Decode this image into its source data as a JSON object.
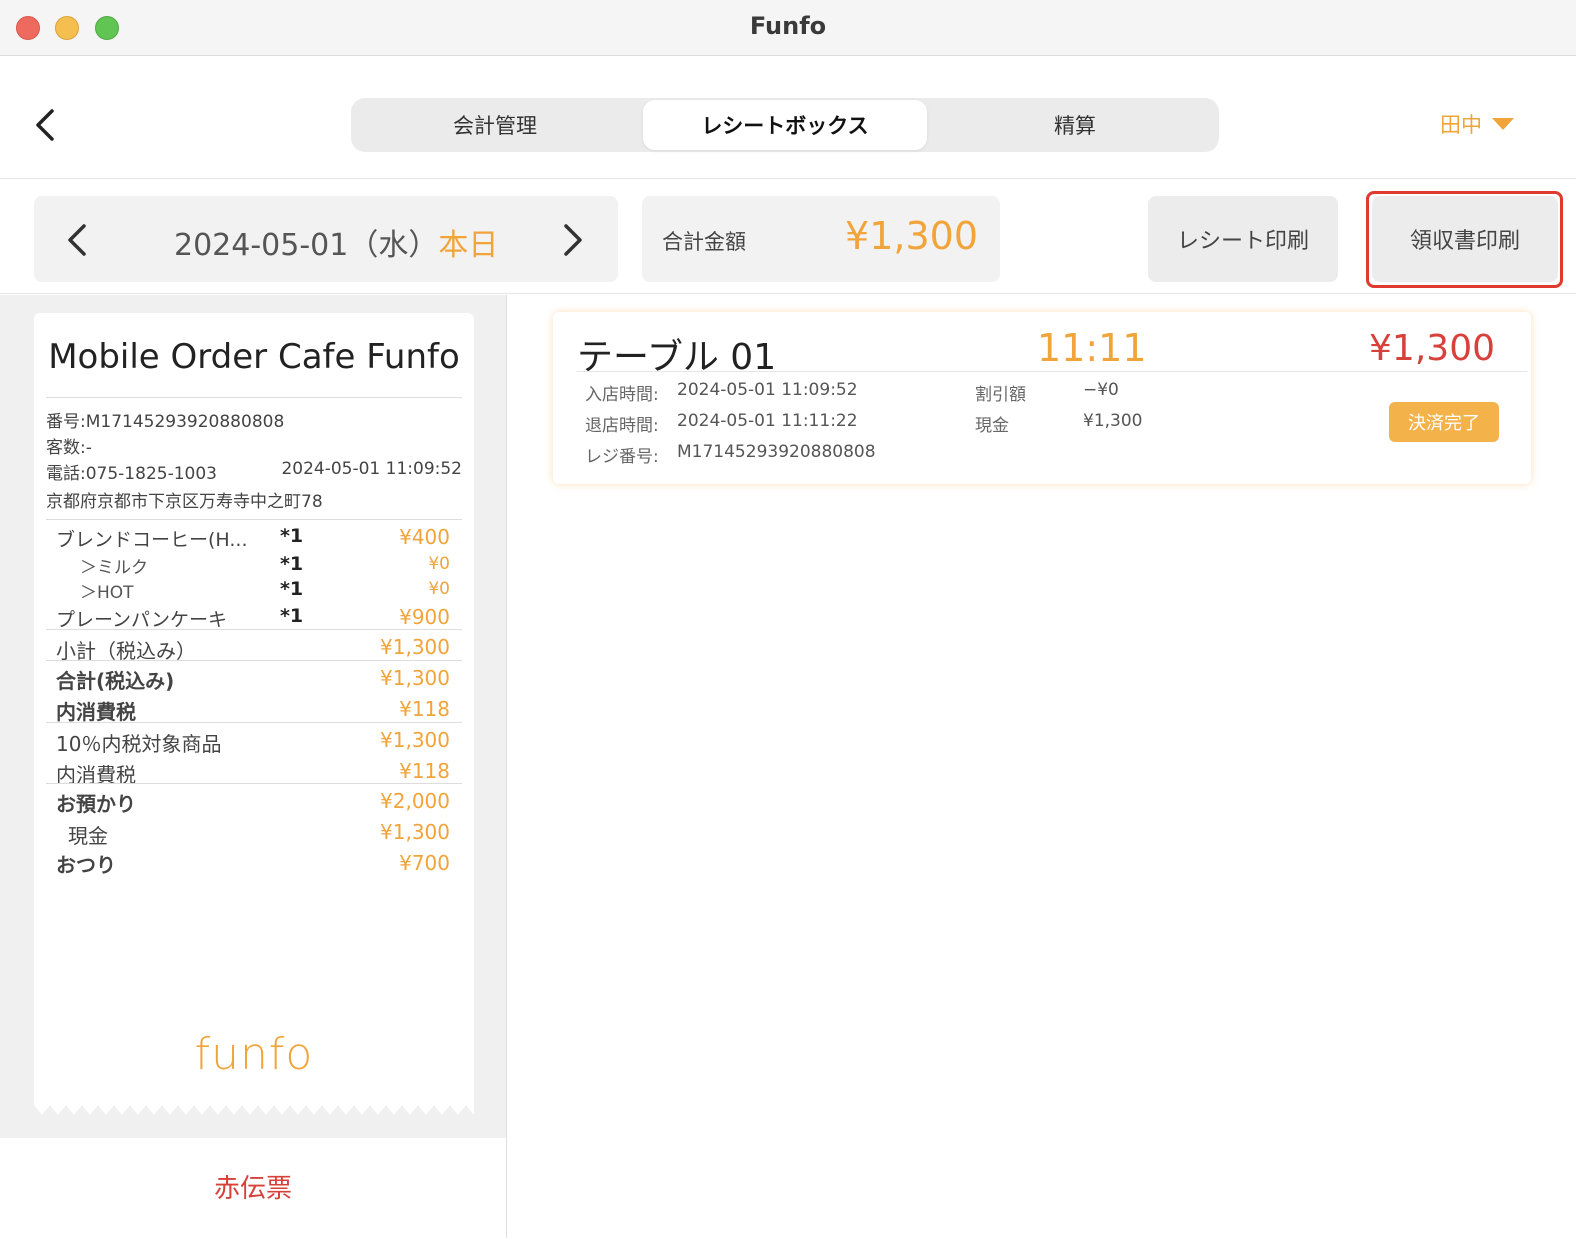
{
  "window": {
    "title": "Funfo"
  },
  "header": {
    "tabs": [
      "会計管理",
      "レシートボックス",
      "精算"
    ],
    "user": "田中"
  },
  "toolbar": {
    "date": "2024-05-01（水）",
    "today_label": "本日",
    "total_label": "合計金額",
    "total_value": "¥1,300",
    "receipt_print": "レシート印刷",
    "invoice_print": "領収書印刷"
  },
  "receipt": {
    "store_name": "Mobile Order Cafe Funfo",
    "number": "番号:M17145293920880808",
    "guests": "客数:-",
    "phone": "電話:075-1825-1003",
    "datetime": "2024-05-01 11:09:52",
    "address": "京都府京都市下京区万寿寺中之町78",
    "items": [
      {
        "name": "ブレンドコーヒー(H...",
        "qty": "*1",
        "price": "¥400"
      },
      {
        "name": "＞ミルク",
        "qty": "*1",
        "price": "¥0"
      },
      {
        "name": "＞HOT",
        "qty": "*1",
        "price": "¥0"
      },
      {
        "name": "プレーンパンケーキ",
        "qty": "*1",
        "price": "¥900"
      }
    ],
    "subtotal_label": "小計（税込み）",
    "subtotal_value": "¥1,300",
    "total_label": "合計(税込み)",
    "total_value": "¥1,300",
    "tax_label": "内消費税",
    "tax_value": "¥118",
    "taxable_label": "10％内税対象商品",
    "taxable_value": "¥1,300",
    "tax2_label": "内消費税",
    "tax2_value": "¥118",
    "deposit_label": "お預かり",
    "deposit_value": "¥2,000",
    "cash_label": "現金",
    "cash_value": "¥1,300",
    "change_label": "おつり",
    "change_value": "¥700",
    "logo_text": "funfo"
  },
  "left_footer": {
    "red_slip": "赤伝票"
  },
  "card": {
    "table": "テーブル 01",
    "time": "11:11",
    "amount": "¥1,300",
    "entry_label": "入店時間:",
    "entry_value": "2024-05-01 11:09:52",
    "exit_label": "退店時間:",
    "exit_value": "2024-05-01 11:11:22",
    "register_label": "レジ番号:",
    "register_value": "M17145293920880808",
    "discount_label": "割引額",
    "discount_value": "−¥0",
    "cash_label": "現金",
    "cash_value": "¥1,300",
    "status": "決済完了"
  },
  "colors": {
    "accent": "#f0a43a",
    "danger": "#d8403a",
    "highlight": "#e03a2e"
  }
}
